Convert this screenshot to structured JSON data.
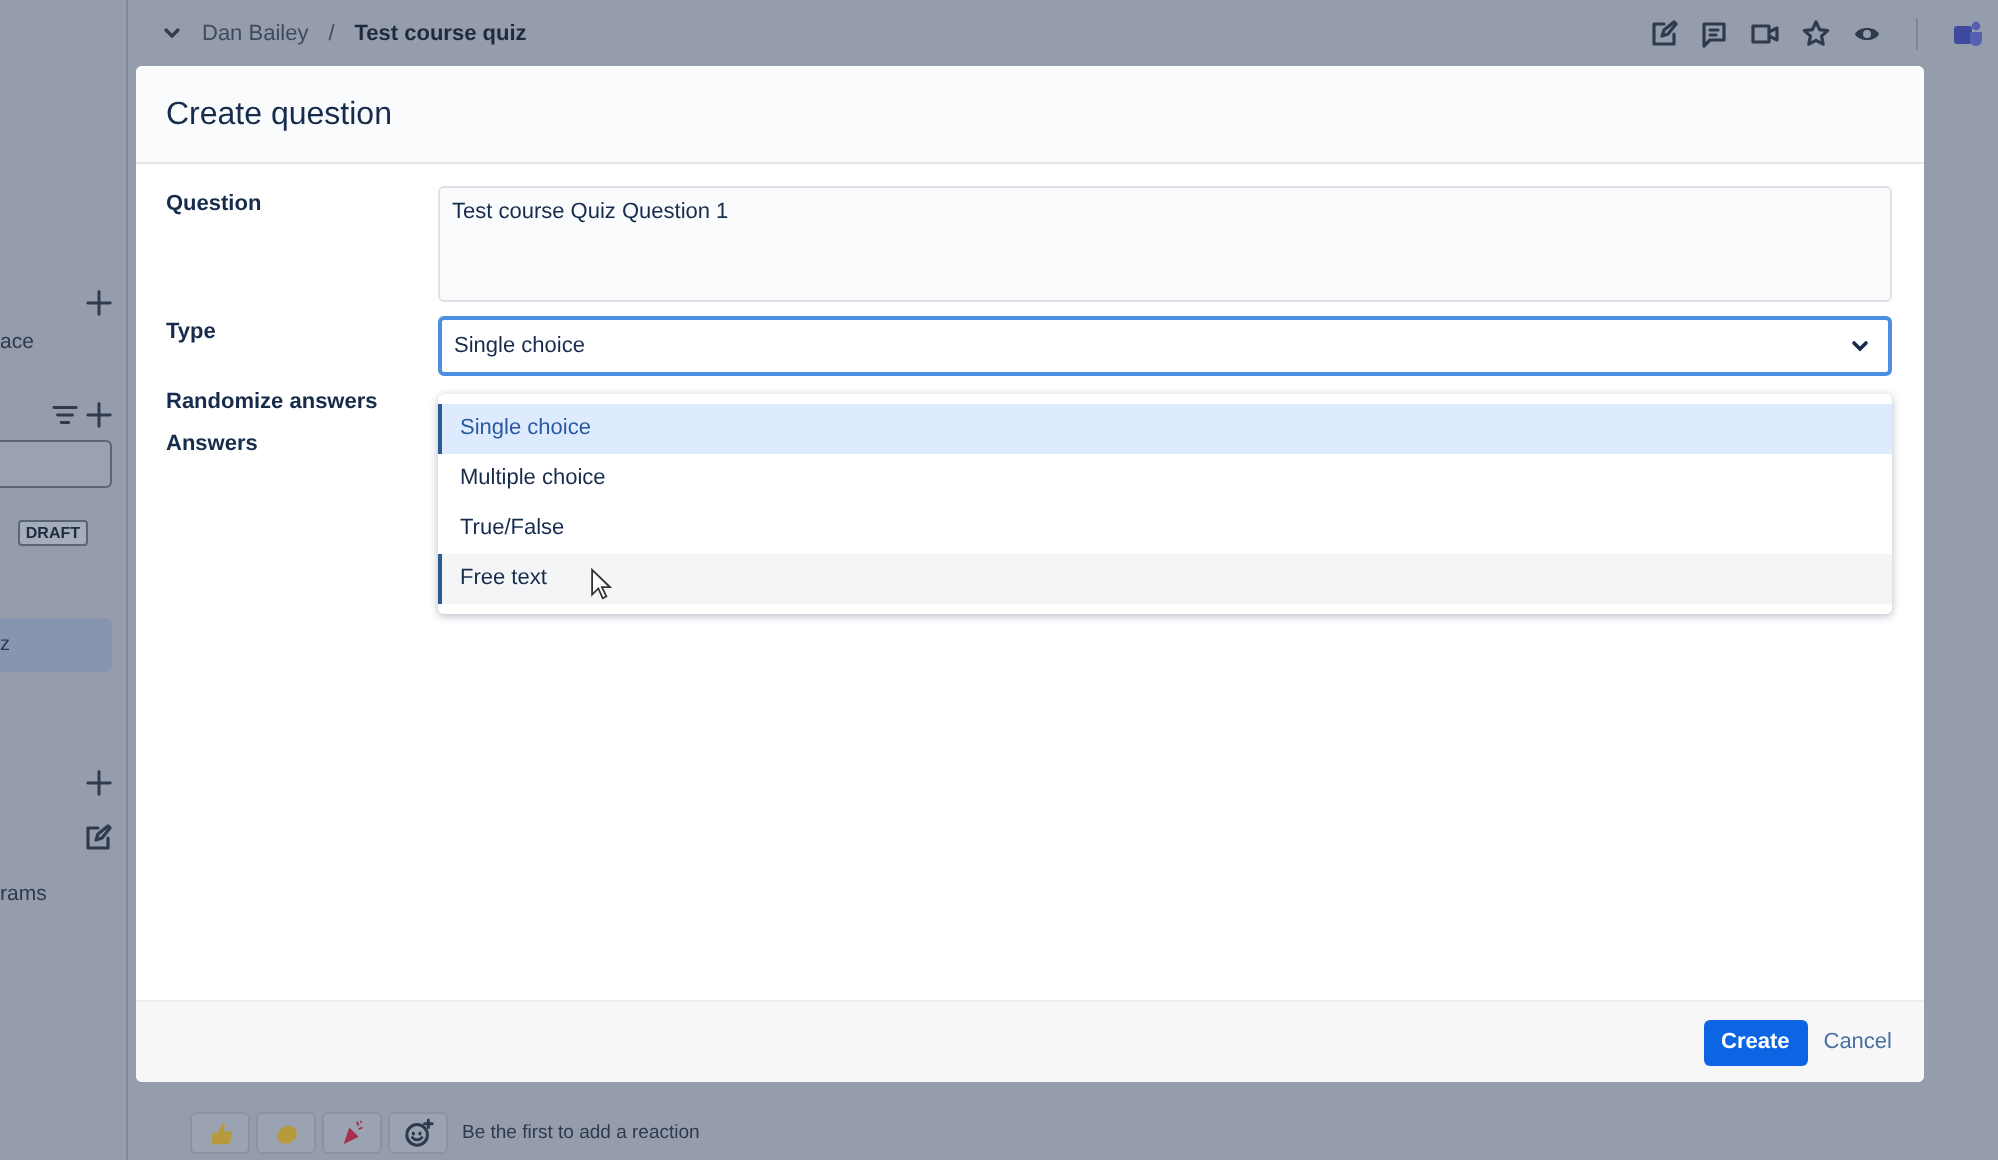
{
  "top_bar": {
    "breadcrumb": [
      {
        "label": "Dan Bailey",
        "current": false
      },
      {
        "label": "Test course quiz",
        "current": true
      }
    ],
    "separator": "/"
  },
  "sidebar": {
    "items": [
      {
        "kind": "add"
      },
      {
        "kind": "text",
        "label": "ace"
      },
      {
        "kind": "filter-add"
      },
      {
        "kind": "input"
      },
      {
        "kind": "badge",
        "label": "DRAFT"
      },
      {
        "kind": "item",
        "label": "z",
        "selected": true
      },
      {
        "kind": "add"
      },
      {
        "kind": "edit"
      },
      {
        "kind": "text",
        "label": "rams"
      }
    ]
  },
  "dialog": {
    "title": "Create question",
    "fields": [
      {
        "kind": "textarea",
        "label": "Question",
        "value": "Test course Quiz Question 1"
      },
      {
        "kind": "select",
        "label": "Type",
        "value": "Single choice",
        "expanded": true,
        "options": [
          {
            "label": "Single choice",
            "selected": true,
            "highlighted": false
          },
          {
            "label": "Multiple choice",
            "selected": false,
            "highlighted": false
          },
          {
            "label": "True/False",
            "selected": false,
            "highlighted": false
          },
          {
            "label": "Free text",
            "selected": false,
            "highlighted": true
          }
        ]
      },
      {
        "kind": "label",
        "label": "Randomize answers"
      },
      {
        "kind": "label",
        "label": "Answers"
      }
    ],
    "buttons": [
      {
        "kind": "primary",
        "label": "Create"
      },
      {
        "kind": "link",
        "label": "Cancel"
      }
    ]
  },
  "reactions": {
    "prompt": "Be the first to add a reaction"
  }
}
